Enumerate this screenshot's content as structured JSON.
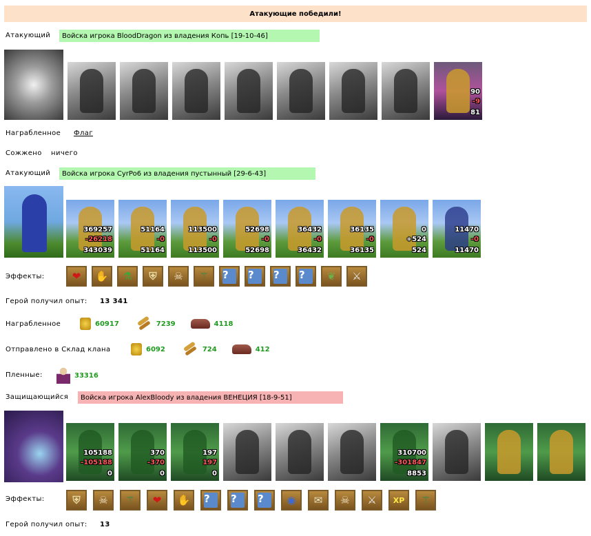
{
  "banner": "Атакующие победили!",
  "side1": {
    "label": "Атакующий",
    "tag": "Войска игрока BloodDragon из владения Копь [19-10-46]",
    "units": [
      {
        "icon": "gray-golem-icon"
      },
      {
        "icon": "gray-warrior-icon"
      },
      {
        "icon": "gray-knight-icon"
      },
      {
        "icon": "gray-griffin-icon"
      },
      {
        "icon": "gray-archer-icon"
      },
      {
        "icon": "gray-monk-icon"
      },
      {
        "icon": "gray-assassin-icon"
      },
      {
        "icon": "dark-mage-icon",
        "n1": "90",
        "n2": "-9",
        "n3": "81"
      }
    ],
    "loot_label": "Награбленное",
    "loot_link": "Флаг",
    "burned_label": "Сожжено",
    "burned_value": "ничего"
  },
  "side2": {
    "label": "Атакующий",
    "tag": "Войска игрока CyrPo6 из владения пустынный [29-6-43]",
    "units": [
      {
        "icon": "worker-icon",
        "n1": "369257",
        "n2": "-26218",
        "n3": "343039"
      },
      {
        "icon": "spearman-icon",
        "n1": "51164",
        "n2": "-0",
        "n3": "51164"
      },
      {
        "icon": "camel-rider-icon",
        "n1": "113500",
        "n2": "-0",
        "n3": "113500"
      },
      {
        "icon": "gold-horse-icon",
        "n1": "52698",
        "n2": "-0",
        "n3": "52698"
      },
      {
        "icon": "crossbowman-icon",
        "n1": "36432",
        "n2": "-0",
        "n3": "36432"
      },
      {
        "icon": "hammer-priest-icon",
        "n1": "36135",
        "n2": "-0",
        "n3": "36135"
      },
      {
        "icon": "blade-warrior-icon",
        "n1": "0",
        "n2": "+524",
        "n3": "524"
      },
      {
        "icon": "wizard-icon",
        "n1": "11470",
        "n2": "-0",
        "n3": "11470"
      }
    ],
    "effects_label": "Эффекты:",
    "effects": [
      "heart-icon",
      "heart-hand-icon",
      "potion-icon",
      "armor-swap-icon",
      "skull-swap-icon",
      "staff-icon",
      "question-icon",
      "question-icon",
      "question-icon",
      "question-icon",
      "grape-shield-icon",
      "sword-shield-icon"
    ],
    "xp_label": "Герой получил опыт:",
    "xp_value": "13 341",
    "loot_label": "Награбленное",
    "loot": [
      {
        "icon": "gold-icon",
        "value": "60917"
      },
      {
        "icon": "wheat-icon",
        "value": "7239"
      },
      {
        "icon": "ore-icon",
        "value": "4118"
      }
    ],
    "clan_label": "Отправлено в Склад клана",
    "clan": [
      {
        "icon": "gold-icon",
        "value": "6092"
      },
      {
        "icon": "wheat-icon",
        "value": "724"
      },
      {
        "icon": "ore-icon",
        "value": "412"
      }
    ],
    "prisoners_label": "Пленные:",
    "prisoners_value": "33316"
  },
  "side3": {
    "label": "Защищающийся",
    "tag": "Войска игрока AlexBloody из владения ВЕНЕЦИЯ [18-9-51]",
    "units": [
      {
        "icon": "green-ranger-icon",
        "n1": "105188",
        "n2": "-105188",
        "n3": "0"
      },
      {
        "icon": "green-swordsman-icon",
        "n1": "370",
        "n2": "-370",
        "n3": "0"
      },
      {
        "icon": "green-pikeman-icon",
        "n1": "197",
        "n2": "197",
        "n3": "0"
      },
      {
        "icon": "gray-griffin-icon"
      },
      {
        "icon": "gray-archer-icon"
      },
      {
        "icon": "gray-priest-icon"
      },
      {
        "icon": "green-druid-icon",
        "n1": "310700",
        "n2": "-301847",
        "n3": "8853"
      },
      {
        "icon": "gray-treant-icon"
      },
      {
        "icon": "tower-icon"
      },
      {
        "icon": "magic-tower-icon"
      }
    ],
    "effects_label": "Эффекты:",
    "effects": [
      "armor-swap-icon",
      "skull-swap-icon",
      "staff-icon",
      "heart-icon",
      "heart-hand-icon",
      "question-icon",
      "question-icon",
      "question-icon",
      "orb-icon",
      "scroll-icon",
      "skull-swap-icon",
      "sword-shield-icon",
      "xp-icon",
      "staff-icon"
    ],
    "xp_label": "Герой получил опыт:",
    "xp_value": "13"
  },
  "colors": {
    "win_banner": "#fde1c8",
    "attacker_tag": "#b3f7b0",
    "defender_tag": "#f7b3b3",
    "resource_value": "#1f9a1f"
  }
}
